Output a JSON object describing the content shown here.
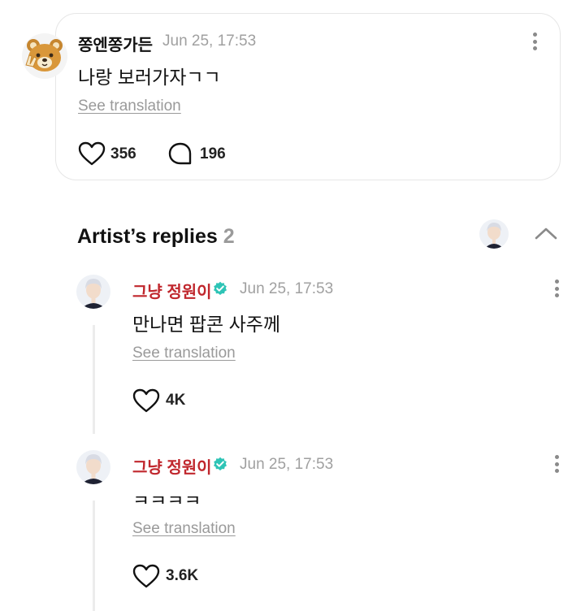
{
  "comment": {
    "author": "쫑엔쫑가든",
    "date": "Jun 25, 17:53",
    "text": "나랑 보러가자ㄱㄱ",
    "translate_label": "See translation",
    "likes": "356",
    "replies": "196",
    "avatar_icon": "bear-avatar"
  },
  "artist_replies": {
    "title": "Artist’s replies",
    "count": "2",
    "items": [
      {
        "author": "그냥 정원이",
        "date": "Jun 25, 17:53",
        "text": "만나면 팝콘 사주께",
        "translate_label": "See translation",
        "likes": "4K"
      },
      {
        "author": "그냥 정원이",
        "date": "Jun 25, 17:53",
        "text": "ㅋㅋㅋㅋ",
        "translate_label": "See translation",
        "likes": "3.6K"
      }
    ]
  },
  "colors": {
    "artist_name": "#c0272d",
    "verified_badge": "#2ec4b6",
    "muted": "#9a9a9a"
  }
}
